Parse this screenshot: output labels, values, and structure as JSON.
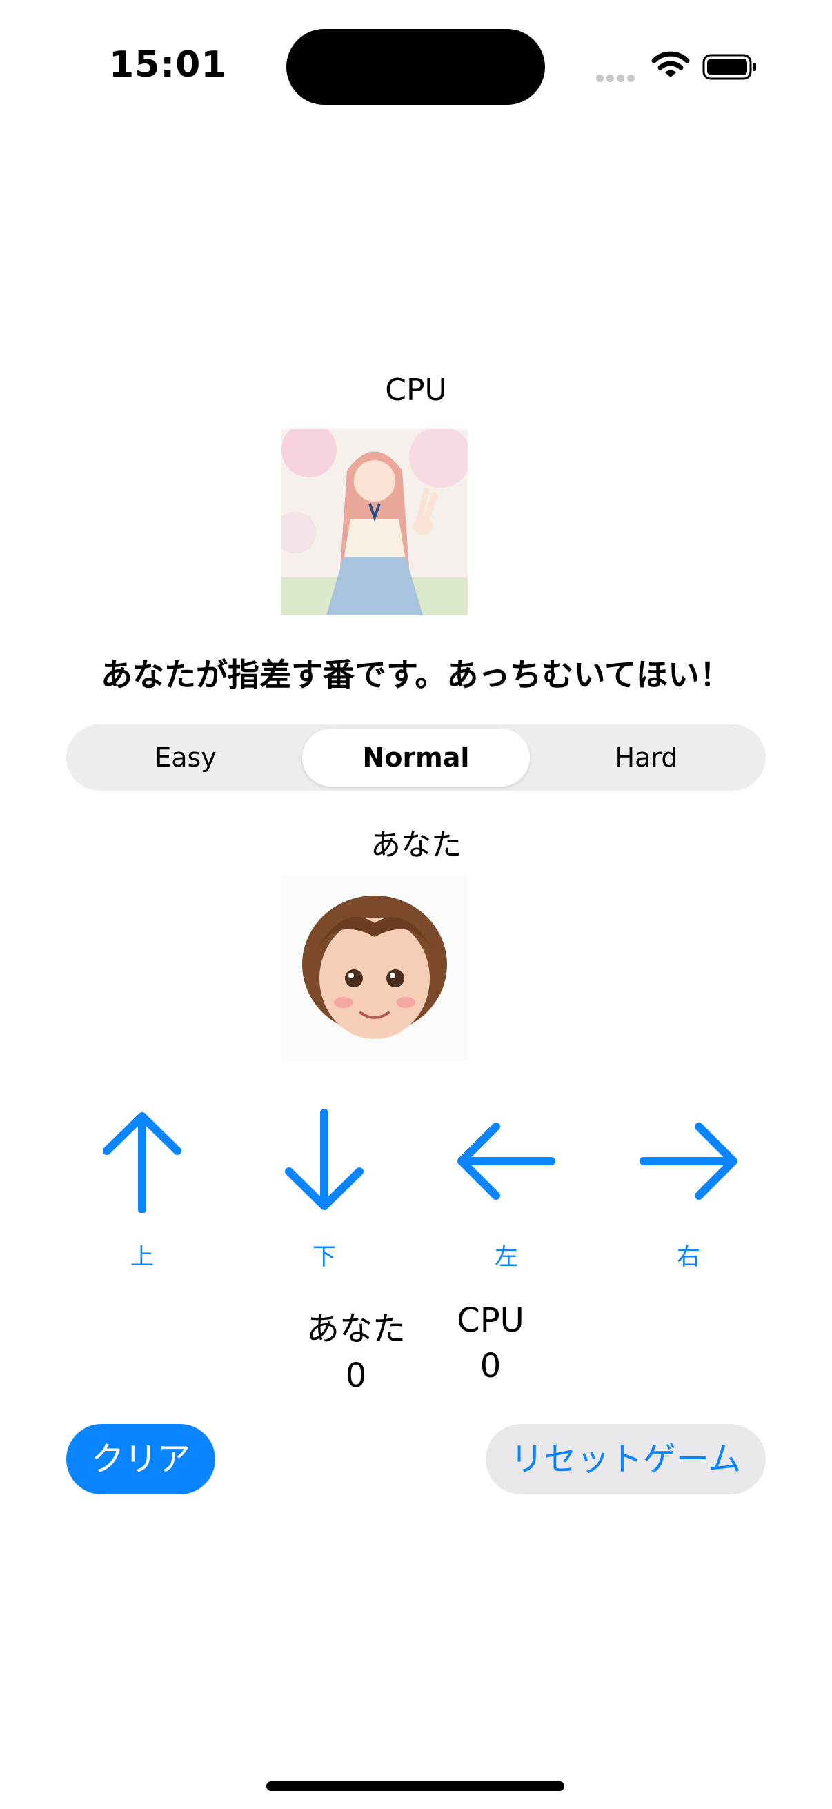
{
  "status_bar": {
    "time": "15:01"
  },
  "cpu": {
    "label": "CPU"
  },
  "message": "あなたが指差す番です。あっちむいてほい！",
  "difficulty": {
    "options": [
      "Easy",
      "Normal",
      "Hard"
    ],
    "selected": "Normal"
  },
  "player": {
    "label": "あなた"
  },
  "directions": {
    "up": "上",
    "down": "下",
    "left": "左",
    "right": "右"
  },
  "score": {
    "you_label": "あなた",
    "you_value": "0",
    "cpu_label": "CPU",
    "cpu_value": "0"
  },
  "buttons": {
    "clear": "クリア",
    "reset": "リセットゲーム"
  },
  "colors": {
    "accent": "#0a84ff",
    "segment_bg": "#eeeeef",
    "reset_bg": "#e9e9eb"
  }
}
